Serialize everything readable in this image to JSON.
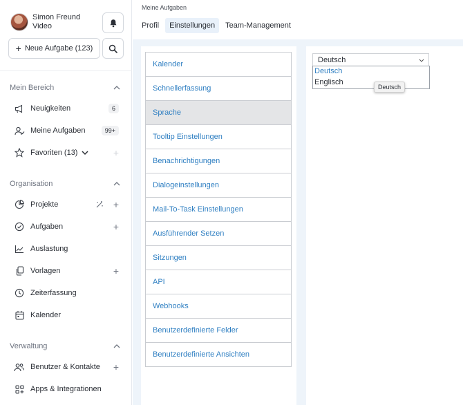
{
  "user": {
    "name": "Simon Freund",
    "role": "Video"
  },
  "actions": {
    "new_task_label": "Neue Aufgabe (123)"
  },
  "sections": {
    "mein_bereich": "Mein Bereich",
    "organisation": "Organisation",
    "verwaltung": "Verwaltung"
  },
  "nav": {
    "neuigkeiten": {
      "label": "Neuigkeiten",
      "badge": "6"
    },
    "meine_aufgaben": {
      "label": "Meine Aufgaben",
      "badge": "99+"
    },
    "favoriten": {
      "label": "Favoriten (13)"
    },
    "projekte": {
      "label": "Projekte"
    },
    "aufgaben": {
      "label": "Aufgaben"
    },
    "auslastung": {
      "label": "Auslastung"
    },
    "vorlagen": {
      "label": "Vorlagen"
    },
    "zeiterfassung": {
      "label": "Zeiterfassung"
    },
    "kalender": {
      "label": "Kalender"
    },
    "benutzer": {
      "label": "Benutzer & Kontakte"
    },
    "apps": {
      "label": "Apps & Integrationen"
    }
  },
  "header": {
    "breadcrumb": "Meine Aufgaben",
    "tabs": [
      "Profil",
      "Einstellungen",
      "Team-Management"
    ],
    "active_tab": "Einstellungen"
  },
  "settings": {
    "items": [
      "Kalender",
      "Schnellerfassung",
      "Sprache",
      "Tooltip Einstellungen",
      "Benachrichtigungen",
      "Dialogeinstellungen",
      "Mail-To-Task Einstellungen",
      "Ausführender Setzen",
      "Sitzungen",
      "API",
      "Webhooks",
      "Benutzerdefinierte Felder",
      "Benutzerdefinierte Ansichten"
    ],
    "selected": "Sprache"
  },
  "language": {
    "current": "Deutsch",
    "options": [
      "Deutsch",
      "Englisch"
    ],
    "tooltip": "Deutsch"
  },
  "colors": {
    "accent": "#2f7fc2",
    "content_bg": "#eef4fa",
    "selected_row": "#e4e5e7",
    "active_tab_bg": "#e9f1fa"
  }
}
